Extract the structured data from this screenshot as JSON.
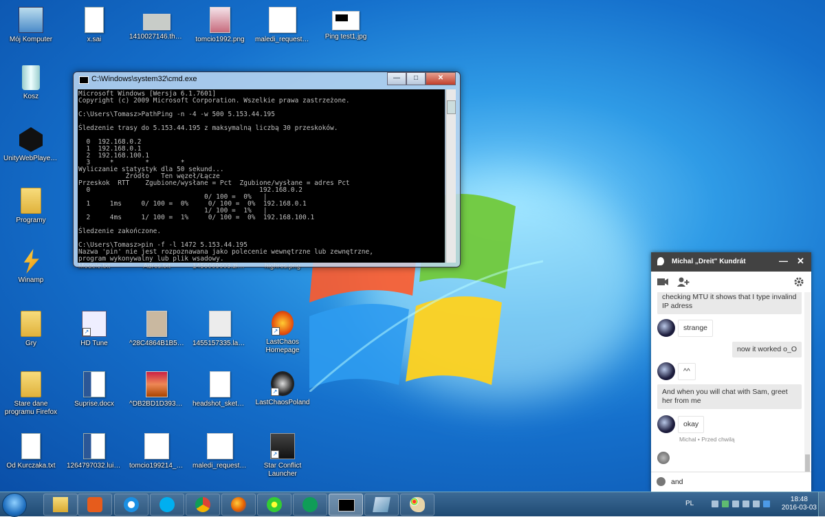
{
  "desktop": {
    "icons": [
      {
        "label": "Mój Komputer"
      },
      {
        "label": "x.sai"
      },
      {
        "label": "1410027146.thorai..."
      },
      {
        "label": "tomcio1992.png"
      },
      {
        "label": "maledi_request2.jpg"
      },
      {
        "label": "Ping test1.jpg"
      },
      {
        "label": "Kosz"
      },
      {
        "label": "UnityWebPlayer.exe"
      },
      {
        "label": "Programy"
      },
      {
        "label": "Winamp"
      },
      {
        "label": "Modele.txt"
      },
      {
        "label": "Adres.txt"
      },
      {
        "label": "1456069603.zinnic..."
      },
      {
        "label": "highres.png"
      },
      {
        "label": "Gry"
      },
      {
        "label": "HD Tune"
      },
      {
        "label": "^28C4864B1B524..."
      },
      {
        "label": "1455157335.ladydi..."
      },
      {
        "label": "LastChaos Homepage"
      },
      {
        "label": "Stare dane programu Firefox"
      },
      {
        "label": "Suprise.docx"
      },
      {
        "label": "^DB2BD1D393GB..."
      },
      {
        "label": "headshot_sketch_..."
      },
      {
        "label": "LastChaosPoland"
      },
      {
        "label": "Od Kurczaka.txt"
      },
      {
        "label": "1264797032.luircin..."
      },
      {
        "label": "tomcio199214_ske..."
      },
      {
        "label": "maledi_request1.jpg"
      },
      {
        "label": "Star Conflict Launcher"
      }
    ]
  },
  "cmd": {
    "title": "C:\\Windows\\system32\\cmd.exe",
    "buttons": {
      "minimize": "—",
      "maximize": "□",
      "close": "✕"
    },
    "output": "Microsoft Windows [Wersja 6.1.7601]\nCopyright (c) 2009 Microsoft Corporation. Wszelkie prawa zastrzeżone.\n\nC:\\Users\\Tomasz>PathPing -n -4 -w 500 5.153.44.195\n\nŚledzenie trasy do 5.153.44.195 z maksymalną liczbą 30 przeskoków.\n\n  0  192.168.0.2\n  1  192.168.0.1\n  2  192.168.100.1\n  3     *        *        *\nWyliczanie statystyk dla 50 sekund...\n            Źródło   Ten węzeł/Łącze\nPrzeskok  RTT    Zgubione/wysłane = Pct  Zgubione/wysłane = adres Pct\n  0                                           192.168.0.2\n                                0/ 100 =  0%   |\n  1     1ms     0/ 100 =  0%     0/ 100 =  0%  192.168.0.1\n                                1/ 100 =  1%   |\n  2     4ms     1/ 100 =  1%     0/ 100 =  0%  192.168.100.1\n\nŚledzenie zakończone.\n\nC:\\Users\\Tomasz>pin -f -l 1472 5.153.44.195\nNazwa 'pin' nie jest rozpoznawana jako polecenie wewnętrzne lub zewnętrzne,\nprogram wykonywalny lub plik wsadowy."
  },
  "chat": {
    "contact": "Michal „Dreit\" Kundrát",
    "minimize": "—",
    "close": "✕",
    "messages": [
      {
        "dir": "out",
        "text": "checking MTU it shows that I type invalind IP adress"
      },
      {
        "dir": "in",
        "text": "strange"
      },
      {
        "dir": "out",
        "text": "now it worked o_O"
      },
      {
        "dir": "in",
        "text": "^^"
      },
      {
        "dir": "out",
        "text": "And when you will chat with Sam, greet her from me"
      },
      {
        "dir": "in",
        "text": "okay"
      }
    ],
    "meta": "Michal • Przed chwilą",
    "input_value": "and"
  },
  "taskbar": {
    "apps": [
      "explorer",
      "media-player",
      "internet-explorer",
      "skype",
      "chrome",
      "firefox",
      "icq",
      "hangouts",
      "cmd",
      "window-app",
      "paint"
    ],
    "lang": "PL",
    "time": "18:48",
    "date": "2016-03-03"
  }
}
